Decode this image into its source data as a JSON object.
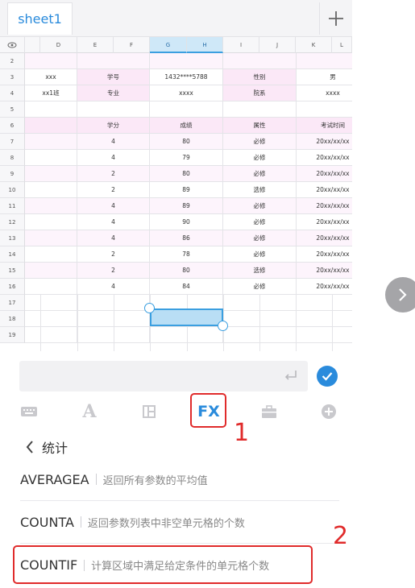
{
  "sheet_tab": {
    "label": "sheet1",
    "add_icon": "plus-icon"
  },
  "columns": [
    "D",
    "E",
    "F",
    "G",
    "H",
    "I",
    "J",
    "K",
    "L"
  ],
  "rows": [
    {
      "n": "2",
      "cells": [
        "",
        "",
        "",
        "",
        "",
        "",
        "",
        ""
      ]
    },
    {
      "n": "3",
      "cells": [
        "xxx",
        "学号",
        "1432****5788",
        "",
        "性别",
        "",
        "男",
        ""
      ]
    },
    {
      "n": "4",
      "cells": [
        "xx1班",
        "专业",
        "xxxx",
        "",
        "院系",
        "",
        "xxxx",
        ""
      ]
    },
    {
      "n": "5",
      "cells": [
        "",
        "",
        "",
        "",
        "",
        "",
        "",
        ""
      ]
    },
    {
      "n": "6",
      "cells": [
        "",
        "学分",
        "成绩",
        "",
        "属性",
        "",
        "考试时间",
        ""
      ]
    },
    {
      "n": "7",
      "cells": [
        "",
        "4",
        "80",
        "",
        "必修",
        "",
        "20xx/xx/xx",
        ""
      ]
    },
    {
      "n": "8",
      "cells": [
        "",
        "4",
        "79",
        "",
        "必修",
        "",
        "20xx/xx/xx",
        ""
      ]
    },
    {
      "n": "9",
      "cells": [
        "",
        "2",
        "80",
        "",
        "必修",
        "",
        "20xx/xx/xx",
        ""
      ]
    },
    {
      "n": "10",
      "cells": [
        "",
        "2",
        "89",
        "",
        "选修",
        "",
        "20xx/xx/xx",
        ""
      ]
    },
    {
      "n": "11",
      "cells": [
        "",
        "4",
        "89",
        "",
        "必修",
        "",
        "20xx/xx/xx",
        ""
      ]
    },
    {
      "n": "12",
      "cells": [
        "",
        "4",
        "90",
        "",
        "必修",
        "",
        "20xx/xx/xx",
        ""
      ]
    },
    {
      "n": "13",
      "cells": [
        "",
        "4",
        "86",
        "",
        "必修",
        "",
        "20xx/xx/xx",
        ""
      ]
    },
    {
      "n": "14",
      "cells": [
        "",
        "2",
        "78",
        "",
        "必修",
        "",
        "20xx/xx/xx",
        ""
      ]
    },
    {
      "n": "15",
      "cells": [
        "",
        "2",
        "80",
        "",
        "选修",
        "",
        "20xx/xx/xx",
        ""
      ]
    },
    {
      "n": "16",
      "cells": [
        "",
        "4",
        "84",
        "",
        "必修",
        "",
        "20xx/xx/xx",
        ""
      ]
    },
    {
      "n": "17",
      "cells": [
        "",
        "",
        "",
        "",
        "",
        "",
        "",
        ""
      ]
    },
    {
      "n": "18",
      "cells": [
        "",
        "",
        "",
        "",
        "",
        "",
        "",
        ""
      ]
    },
    {
      "n": "19",
      "cells": [
        "",
        "",
        "",
        "",
        "",
        "",
        "",
        ""
      ]
    }
  ],
  "toolbar": {
    "keyboard_icon": "keyboard-icon",
    "font_label": "A",
    "layout_icon": "layout-icon",
    "fx_label": "FX",
    "briefcase_icon": "briefcase-icon",
    "add_icon": "plus-circle-icon"
  },
  "annotations": {
    "step1": "1",
    "step2": "2"
  },
  "function_panel": {
    "category": "统计",
    "functions": [
      {
        "name": "AVERAGEA",
        "desc": "返回所有参数的平均值"
      },
      {
        "name": "COUNTA",
        "desc": "返回参数列表中非空单元格的个数"
      },
      {
        "name": "COUNTIF",
        "desc": "计算区域中满足给定条件的单元格个数"
      }
    ]
  },
  "colors": {
    "accent": "#2a8bdc",
    "highlight_red": "#e02b2b",
    "header_pink": "#fbe8f7"
  }
}
